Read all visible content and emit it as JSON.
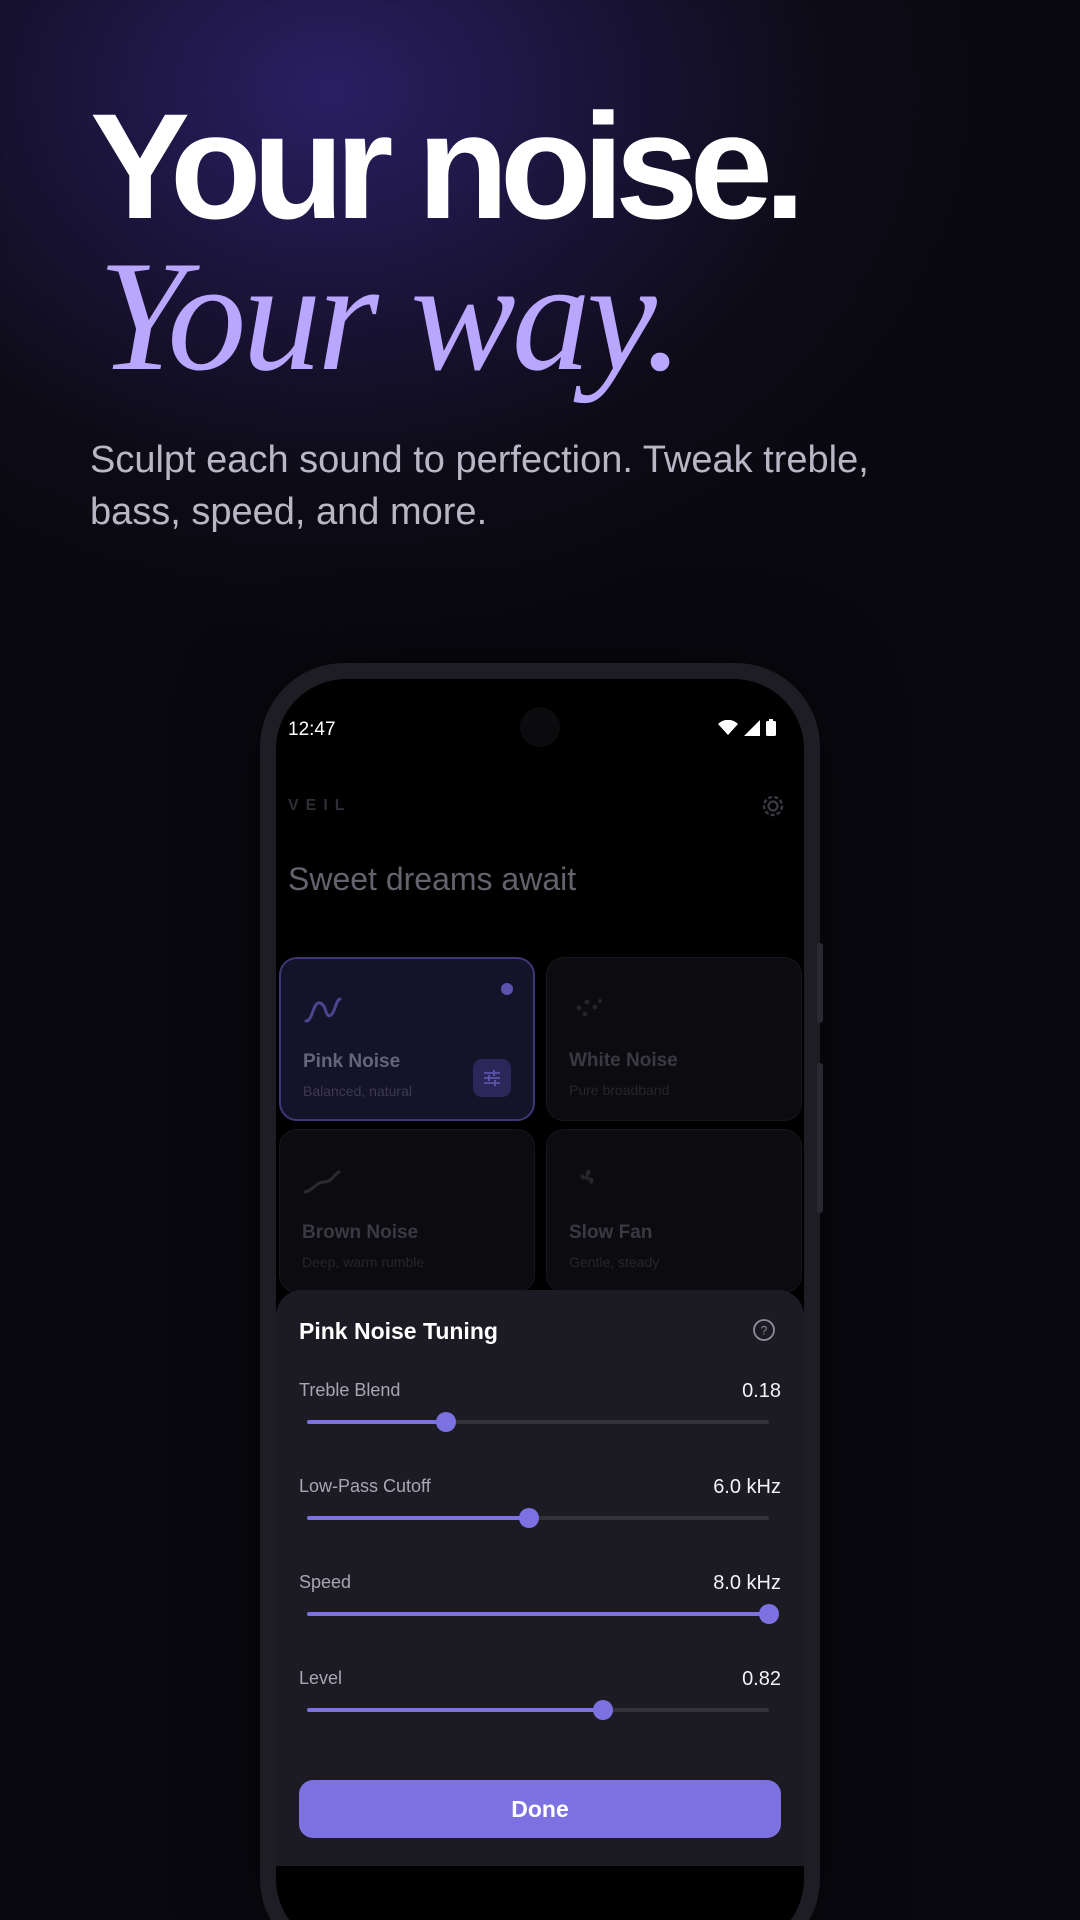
{
  "hero": {
    "line1": "Your noise.",
    "line2": "Your way.",
    "subtitle": "Sculpt each sound to perfection. Tweak treble, bass, speed, and more."
  },
  "status_bar": {
    "time": "12:47"
  },
  "app": {
    "brand": "VEIL",
    "greeting": "Sweet dreams await",
    "cards": [
      {
        "title": "Pink Noise",
        "subtitle": "Balanced, natural",
        "active": true
      },
      {
        "title": "White Noise",
        "subtitle": "Pure broadband",
        "active": false
      },
      {
        "title": "Brown Noise",
        "subtitle": "Deep, warm rumble",
        "active": false
      },
      {
        "title": "Slow Fan",
        "subtitle": "Gentle, steady",
        "active": false
      }
    ]
  },
  "sheet": {
    "title": "Pink Noise Tuning",
    "sliders": [
      {
        "label": "Treble Blend",
        "value": "0.18",
        "fraction": 0.3
      },
      {
        "label": "Low-Pass Cutoff",
        "value": "6.0 kHz",
        "fraction": 0.48
      },
      {
        "label": "Speed",
        "value": "8.0 kHz",
        "fraction": 1.0
      },
      {
        "label": "Level",
        "value": "0.82",
        "fraction": 0.64
      }
    ],
    "done_label": "Done"
  },
  "colors": {
    "accent": "#7b71e0",
    "hero_italic": "#b8a6ff"
  }
}
